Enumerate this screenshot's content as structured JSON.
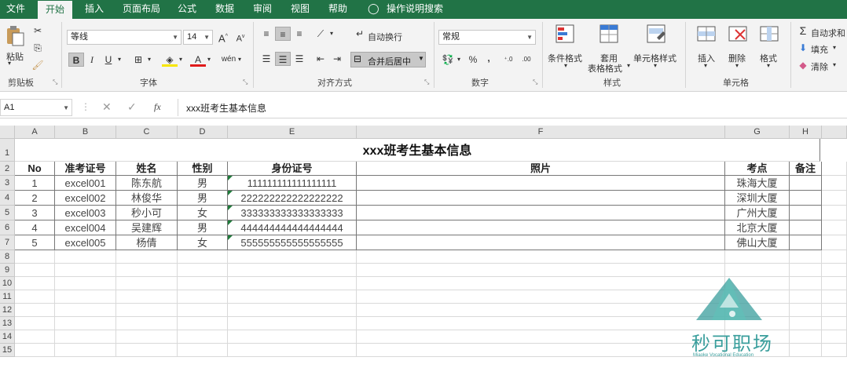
{
  "menu": [
    "文件",
    "开始",
    "插入",
    "页面布局",
    "公式",
    "数据",
    "审阅",
    "视图",
    "帮助",
    "操作说明搜索"
  ],
  "ribbon": {
    "paste": "粘贴",
    "clipboard": "剪贴板",
    "font_name": "等线",
    "font_size": "14",
    "bold": "B",
    "italic": "I",
    "underline": "U",
    "font_group": "字体",
    "wrap": "自动换行",
    "merge": "合并后居中",
    "align_group": "对齐方式",
    "number_format": "常规",
    "percent": "%",
    "comma": ",",
    "number_group": "数字",
    "cond_format": "条件格式",
    "table_format_1": "套用",
    "table_format_2": "表格格式",
    "cell_style": "单元格样式",
    "styles_group": "样式",
    "insert": "插入",
    "delete": "删除",
    "format": "格式",
    "cells_group": "单元格",
    "autosum": "自动求和",
    "fill": "填充",
    "clear": "清除"
  },
  "formula_bar": {
    "name_box": "A1",
    "fx": "fx",
    "content": "xxx班考生基本信息"
  },
  "columns": [
    "A",
    "B",
    "C",
    "D",
    "E",
    "F",
    "G",
    "H"
  ],
  "rows": [
    "1",
    "2",
    "3",
    "4",
    "5",
    "6",
    "7",
    "8",
    "9",
    "10",
    "11",
    "12",
    "13",
    "14",
    "15"
  ],
  "sheet": {
    "title": "xxx班考生基本信息",
    "headers": [
      "No",
      "准考证号",
      "姓名",
      "性别",
      "身份证号",
      "照片",
      "考点",
      "备注"
    ],
    "data": [
      [
        "1",
        "excel001",
        "陈东航",
        "男",
        "111111111111111111",
        "",
        "珠海大厦",
        ""
      ],
      [
        "2",
        "excel002",
        "林俊华",
        "男",
        "222222222222222222",
        "",
        "深圳大厦",
        ""
      ],
      [
        "3",
        "excel003",
        "秒小可",
        "女",
        "333333333333333333",
        "",
        "广州大厦",
        ""
      ],
      [
        "4",
        "excel004",
        "吴建辉",
        "男",
        "444444444444444444",
        "",
        "北京大厦",
        ""
      ],
      [
        "5",
        "excel005",
        "杨倩",
        "女",
        "555555555555555555",
        "",
        "佛山大厦",
        ""
      ]
    ]
  },
  "watermark": {
    "name": "秒可职场",
    "sub": "Miaoke Vocational Education"
  },
  "colors": {
    "accent": "#217346",
    "watermark": "#3a9e9c"
  }
}
